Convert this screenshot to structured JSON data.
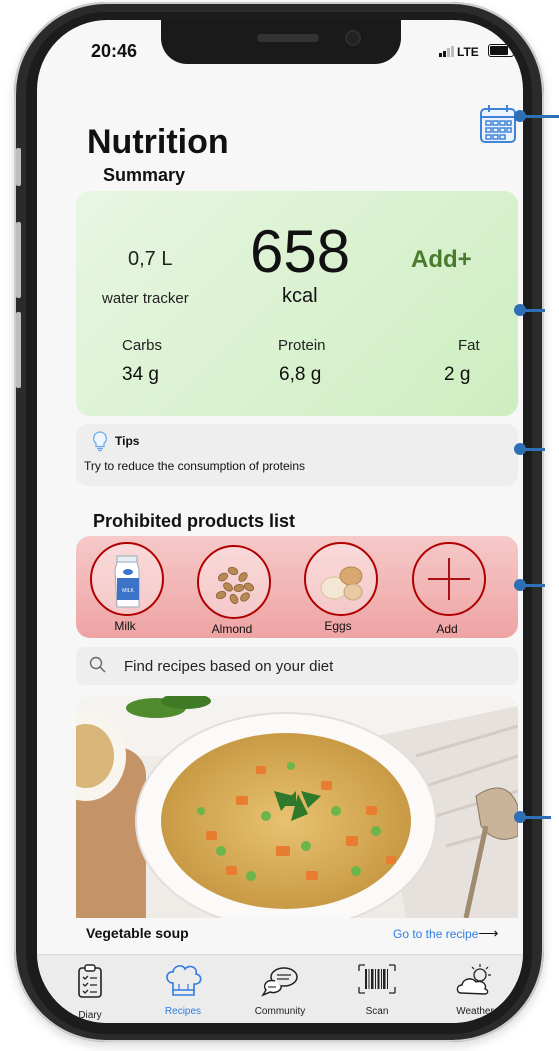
{
  "status_bar": {
    "time": "20:46",
    "network": "LTE"
  },
  "header": {
    "title": "Nutrition",
    "calendar_icon": "calendar-icon"
  },
  "summary": {
    "section_title": "Summary",
    "water_value": "0,7 L",
    "water_label": "water tracker",
    "calories_value": "658",
    "calories_unit": "kcal",
    "add_label": "Add+",
    "macros": [
      {
        "label": "Carbs",
        "value": "34 g"
      },
      {
        "label": "Protein",
        "value": "6,8 g"
      },
      {
        "label": "Fat",
        "value": "2 g"
      }
    ]
  },
  "tips": {
    "title": "Tips",
    "text": "Try to reduce the consumption of proteins",
    "icon": "lightbulb-icon"
  },
  "prohibited": {
    "section_title": "Prohibited products list",
    "items": [
      {
        "label": "Milk",
        "icon": "milk-carton-icon"
      },
      {
        "label": "Almond",
        "icon": "almond-icon"
      },
      {
        "label": "Eggs",
        "icon": "eggs-icon"
      },
      {
        "label": "Add",
        "icon": "plus-icon"
      }
    ]
  },
  "search": {
    "placeholder": "Find recipes based on your diet"
  },
  "recipe": {
    "name": "Vegetable soup",
    "link": "Go to the recipe"
  },
  "tabs": [
    {
      "label": "Diary",
      "icon": "clipboard-icon",
      "active": false
    },
    {
      "label": "Recipes",
      "icon": "chef-hat-icon",
      "active": true
    },
    {
      "label": "Community",
      "icon": "chat-bubbles-icon",
      "active": false
    },
    {
      "label": "Scan",
      "icon": "barcode-icon",
      "active": false
    },
    {
      "label": "Weather",
      "icon": "weather-icon",
      "active": false
    }
  ],
  "colors": {
    "accent_blue": "#2f7de1",
    "summary_green": "#cdeec0",
    "add_green": "#4a7a2e",
    "prohibited_red": "#eea3a3",
    "circle_red": "#b00000",
    "callout_blue": "#2f6fb6"
  }
}
